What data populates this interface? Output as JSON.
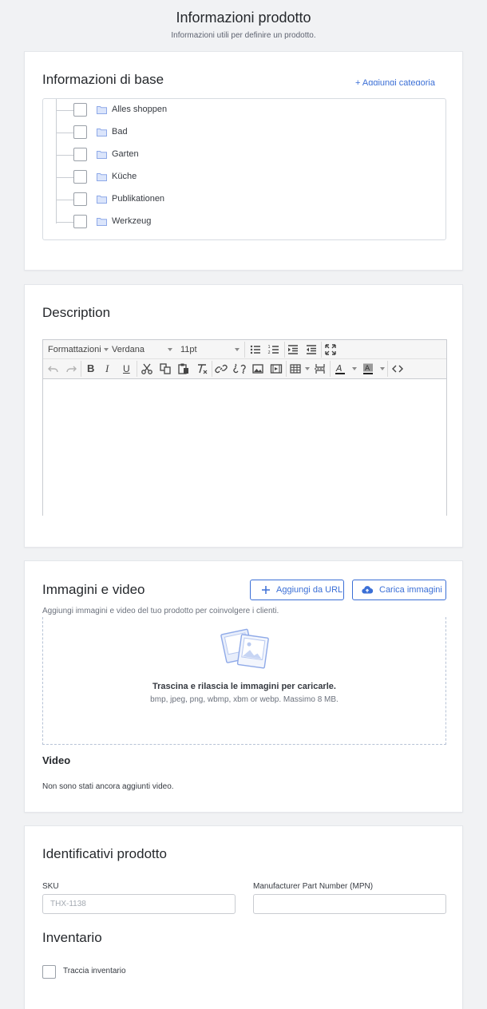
{
  "header": {
    "title": "Informazioni prodotto",
    "subtitle": "Informazioni utili per definire un prodotto."
  },
  "base_info": {
    "title": "Informazioni di base",
    "add_category_label": "+ Aggiungi categoria",
    "categories": [
      {
        "label": "Alles shoppen",
        "checked": false
      },
      {
        "label": "Bad",
        "checked": false
      },
      {
        "label": "Garten",
        "checked": false
      },
      {
        "label": "Küche",
        "checked": false
      },
      {
        "label": "Publikationen",
        "checked": false
      },
      {
        "label": "Werkzeug",
        "checked": false
      }
    ]
  },
  "description": {
    "title": "Description",
    "toolbar": {
      "format_label": "Formattazioni",
      "font_family": "Verdana",
      "font_size": "11pt"
    },
    "content": ""
  },
  "media": {
    "title": "Immagini e video",
    "add_url_label": "Aggiungi da URL",
    "upload_label": "Carica immagini",
    "description": "Aggiungi immagini e video del tuo prodotto per coinvolgere i clienti.",
    "drop_title": "Trascina e rilascia le immagini per caricarle.",
    "drop_formats": "bmp, jpeg, png, wbmp, xbm or webp. Massimo 8 MB.",
    "video_title": "Video",
    "video_empty": "Non sono stati ancora aggiunti video."
  },
  "identifiers": {
    "title": "Identificativi prodotto",
    "sku_label": "SKU",
    "sku_placeholder": "THX-1138",
    "sku_value": "",
    "mpn_label": "Manufacturer Part Number (MPN)",
    "mpn_value": ""
  },
  "inventory": {
    "title": "Inventario",
    "track_label": "Traccia inventario",
    "track_checked": false
  },
  "colors": {
    "accent": "#3b6fd6",
    "folder": "#a9bff0",
    "background": "#f1f2f4"
  }
}
